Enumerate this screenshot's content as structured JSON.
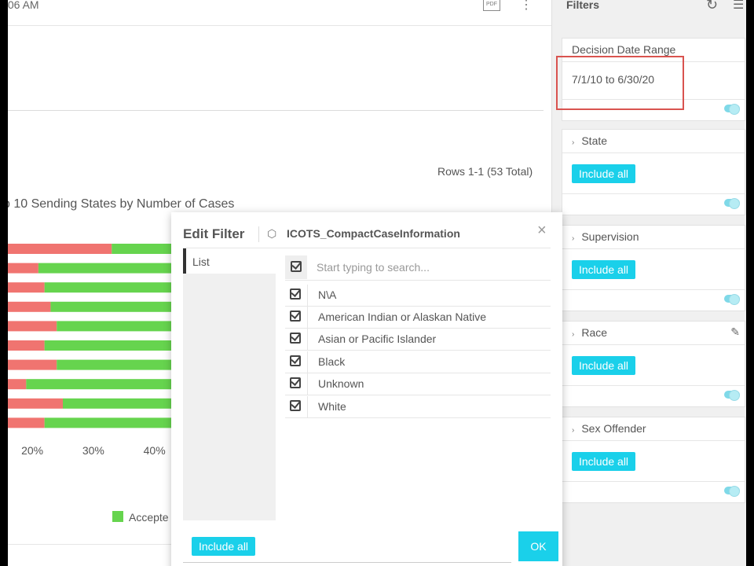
{
  "header": {
    "timestamp": ":06 AM",
    "pdf_label": "PDF",
    "kebab_glyph": "⋮"
  },
  "report": {
    "rows_total": "Rows 1-1 (53 Total)"
  },
  "chart_data": {
    "type": "bar",
    "orientation": "horizontal",
    "stacked": true,
    "title": "p 10 Sending States by Number of Cases",
    "categories": [
      "",
      "",
      "",
      "",
      "",
      "",
      "",
      "",
      "",
      ""
    ],
    "series": [
      {
        "name": "",
        "color": "#f07470",
        "values": [
          0.33,
          0.21,
          0.22,
          0.23,
          0.24,
          0.22,
          0.24,
          0.19,
          0.25,
          0.22
        ]
      },
      {
        "name": "Accepted",
        "color": "#66d44e",
        "values": [
          0.67,
          0.79,
          0.78,
          0.77,
          0.76,
          0.78,
          0.76,
          0.81,
          0.75,
          0.78
        ]
      }
    ],
    "x_tick_labels": [
      "20%",
      "30%",
      "40%"
    ],
    "legend_label": "Accepte",
    "xlim": [
      0.16,
      0.43
    ]
  },
  "filters": {
    "title": "Filters",
    "reset_glyph": "↻",
    "menu_glyph": "☰",
    "date_range": {
      "label": "Decision Date Range",
      "value": "7/1/10 to 6/30/20"
    },
    "cards": [
      {
        "label": "State",
        "chip": "Include all"
      },
      {
        "label": "Supervision",
        "chip": "Include all"
      },
      {
        "label": "Race",
        "chip": "Include all"
      },
      {
        "label": "Sex Offender",
        "chip": "Include all"
      }
    ]
  },
  "dialog": {
    "title": "Edit Filter",
    "table": "ICOTS_CompactCaseInformation",
    "close_glyph": "×",
    "tab_list": "List",
    "search_placeholder": "Start typing to search...",
    "options": [
      "N\\A",
      "American Indian or Alaskan Native",
      "Asian or Pacific Islander",
      "Black",
      "Unknown",
      "White"
    ],
    "include_all": "Include all",
    "ok": "OK"
  },
  "colors": {
    "accent": "#1ad0ea",
    "highlight": "#d9534f",
    "bar_red": "#f07470",
    "bar_green": "#66d44e"
  }
}
